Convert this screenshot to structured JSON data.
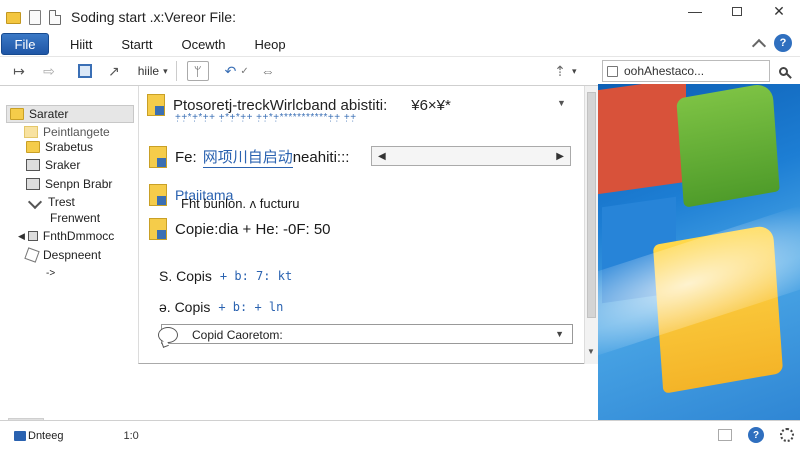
{
  "window": {
    "title": "Soding start .x:Vereor File:",
    "minimize": "—",
    "close": "✕"
  },
  "menu": {
    "file": "File",
    "items": [
      "Hiitt",
      "Startt",
      "Ocewth",
      "Heop"
    ],
    "help": "?"
  },
  "toolbar": {
    "back": "↦",
    "forward": "⇨",
    "pen": "↗",
    "label": "hiile",
    "dropdown": "▾",
    "filter": "ᛘ",
    "small1": "↶",
    "small2": "✓",
    "small3": "⇔",
    "nav_up": "⇡",
    "nav_dd": "▾",
    "search_text": "oohAhestaco..."
  },
  "sidebar": {
    "items": [
      {
        "label": "Sarater"
      },
      {
        "label": "Peintlangete"
      },
      {
        "label": "Srabetus"
      },
      {
        "label": "Sraker"
      },
      {
        "label": "Senpn Brabr"
      },
      {
        "label": "Trest"
      },
      {
        "label": "Frenwent"
      },
      {
        "label": "FnthDmmocc"
      },
      {
        "label": "Despneent"
      },
      {
        "label": "->"
      }
    ],
    "arrow": "◀"
  },
  "main": {
    "row1_title": "Ptosoretj-treckWirlcband abistiti:",
    "row1_suffix": "¥6×¥*",
    "row1_sub": "+̣+̣*+̣*+̣+ +̣*+̣*+̣+ +̣+̣*+̣***********+̣+̣ +̣+̣",
    "row1_dd": "▼",
    "row2_prefix": "Fe:",
    "row2_link": "网项川自启动",
    "row2_suffix": "neahiti:::",
    "combo_left": "◀",
    "combo_right": "▶",
    "row3_link": "Ptaiitama",
    "row3_sub": "Fht bunlon. ʌ fucturu",
    "row4": "Copie:dia + He: -0F: 50",
    "copis1_label": "S. Copis",
    "copis1_value": "+ b: 7: kt",
    "copis2_label": "ə. Copis",
    "copis2_value": "+ b: + ln",
    "search_text": "Copid Caoretom:",
    "search_dd": "▼",
    "scroll_dd": "▼"
  },
  "status": {
    "label": "Dnteeg",
    "time": "1:0",
    "help": "?"
  }
}
